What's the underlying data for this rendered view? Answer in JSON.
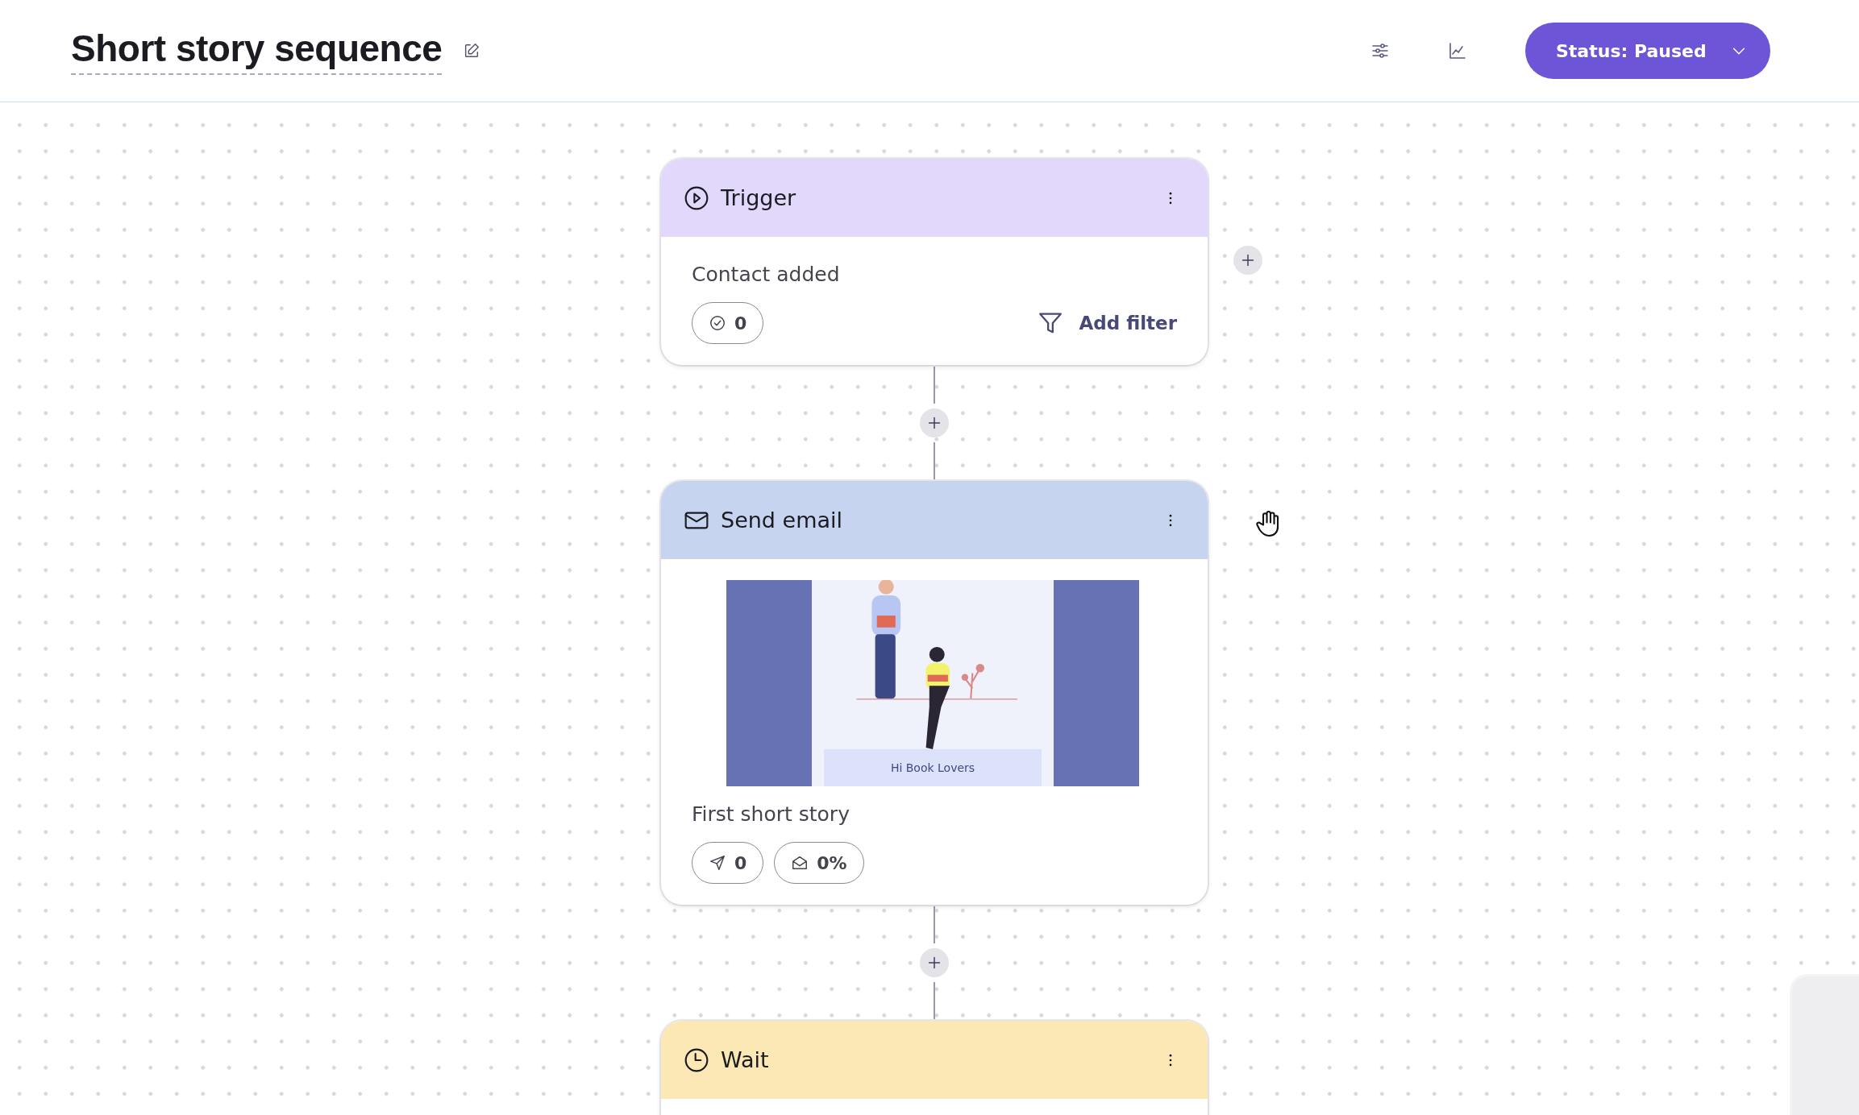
{
  "header": {
    "title": "Short story sequence",
    "status_button": "Status: Paused"
  },
  "nodes": [
    {
      "kind": "trigger",
      "title": "Trigger",
      "subtitle": "Contact added",
      "stats": [
        {
          "kind": "check",
          "value": "0"
        }
      ],
      "action": "Add filter"
    },
    {
      "kind": "email",
      "title": "Send email",
      "preview": {
        "kind": "picture",
        "banner": "Hi Book Lovers"
      },
      "subtitle": "First short story",
      "stats": [
        {
          "kind": "sent",
          "value": "0"
        },
        {
          "kind": "opened",
          "value": "0%"
        }
      ]
    },
    {
      "kind": "wait",
      "title": "Wait"
    }
  ]
}
